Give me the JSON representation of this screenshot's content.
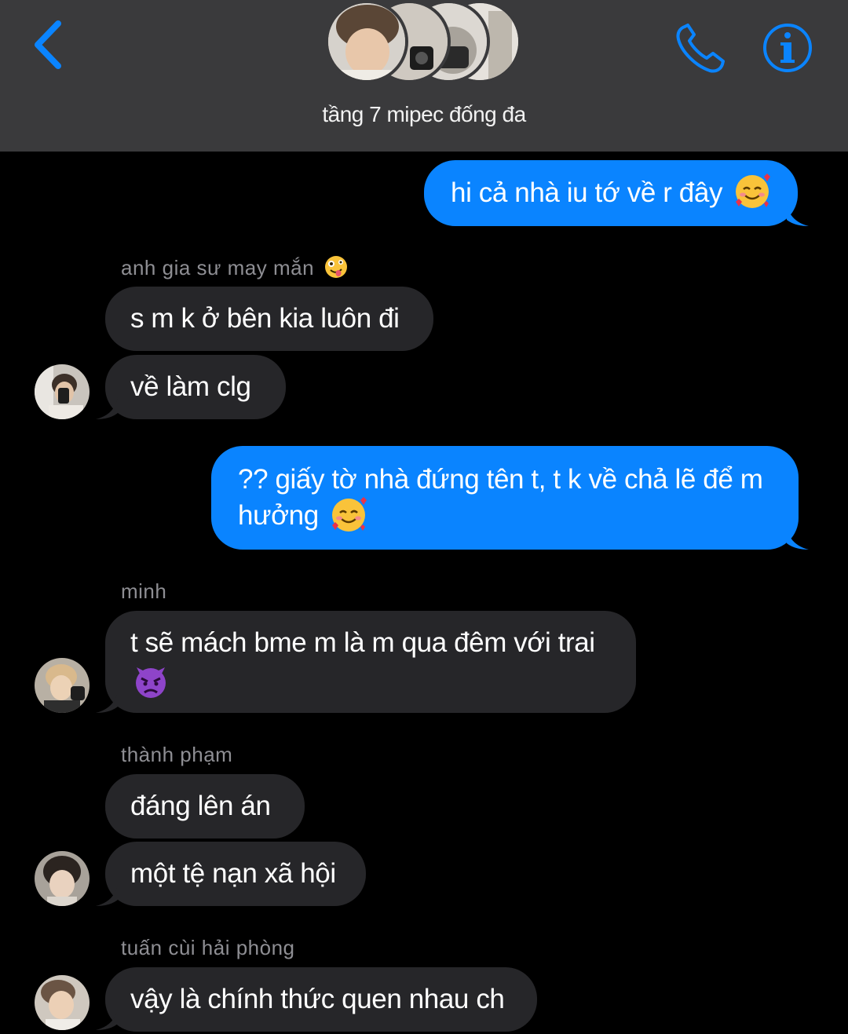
{
  "header": {
    "title": "tầng 7 mipec đống đa",
    "accent_color": "#0a84ff",
    "back_icon": "chevron-left-icon",
    "call_icon": "phone-icon",
    "info_icon": "info-icon"
  },
  "messages": [
    {
      "direction": "outgoing",
      "text": "hi cả nhà iu tớ về r đây",
      "emoji": "smiling-face-with-hearts"
    },
    {
      "direction": "incoming",
      "sender": "anh gia sư may mắn",
      "sender_emoji": "zany-face",
      "text": "s m k ở bên kia luôn đi"
    },
    {
      "direction": "incoming",
      "text": "về làm clg"
    },
    {
      "direction": "outgoing",
      "line1": "?? giấy tờ nhà đứng tên t, t k về chả lẽ để m",
      "line2": "hưởng",
      "emoji": "smiling-face-with-hearts"
    },
    {
      "direction": "incoming",
      "sender": "minh",
      "text": "t sẽ mách bme m là m qua đêm với trai",
      "emoji": "angry-face-with-horns"
    },
    {
      "direction": "incoming",
      "sender": "thành phạm",
      "text": "đáng lên án"
    },
    {
      "direction": "incoming",
      "text": "một tệ nạn xã hội"
    },
    {
      "direction": "incoming",
      "sender": "tuấn cùi hải phòng",
      "text": "vậy là chính thức quen nhau ch"
    }
  ]
}
